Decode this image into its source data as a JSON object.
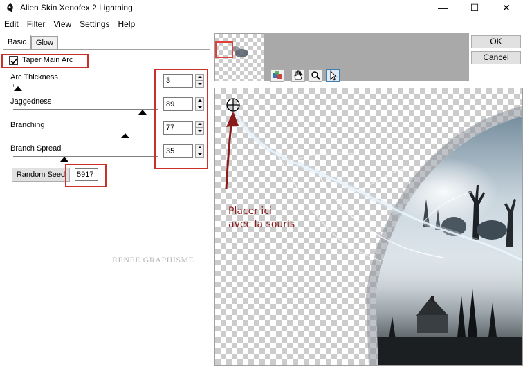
{
  "window": {
    "title": "Alien Skin Xenofex 2 Lightning",
    "controls": [
      "—",
      "☐",
      "✕"
    ]
  },
  "menu": [
    "Edit",
    "Filter",
    "View",
    "Settings",
    "Help"
  ],
  "tabs": [
    "Basic",
    "Glow"
  ],
  "taper": {
    "label": "Taper Main Arc",
    "checked": true
  },
  "params": [
    {
      "label": "Arc Thickness",
      "value": "3"
    },
    {
      "label": "Jaggedness",
      "value": "89"
    },
    {
      "label": "Branching",
      "value": "77"
    },
    {
      "label": "Branch Spread",
      "value": "35"
    }
  ],
  "seed": {
    "button_label": "Random Seed",
    "value": "5917"
  },
  "watermark": "RENEE GRAPHISME",
  "buttons": {
    "ok": "OK",
    "cancel": "Cancel"
  },
  "annotation": {
    "line1": "Placer ici",
    "line2": "avec la souris"
  },
  "colors": {
    "highlight": "#c9302c",
    "annotation": "#8b1a1a"
  }
}
